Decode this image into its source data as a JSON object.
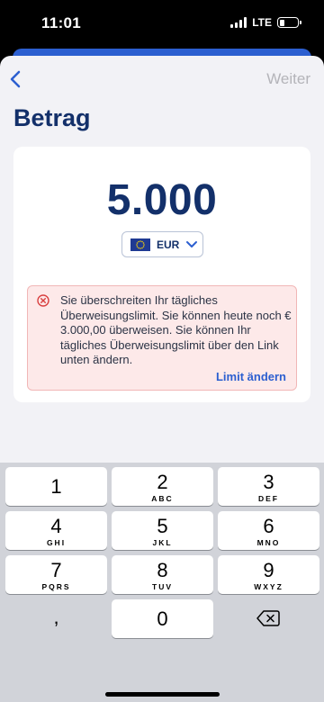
{
  "status_bar": {
    "time": "11:01",
    "network": "LTE",
    "battery_level": 0.2
  },
  "nav": {
    "back_icon": "chevron-left-icon",
    "next_label": "Weiter"
  },
  "page": {
    "title": "Betrag"
  },
  "amount": {
    "value": "5.000",
    "currency": "EUR",
    "flag_icon": "eu-flag-icon"
  },
  "error": {
    "icon": "error-circle-icon",
    "message": "Sie überschreiten Ihr tägliches Überweisungslimit. Sie können heute noch € 3.000,00 überweisen. Sie können Ihr tägliches Überweisungslimit über den Link unten ändern.",
    "link_label": "Limit ändern"
  },
  "keyboard": {
    "keys": [
      {
        "digit": "1",
        "letters": ""
      },
      {
        "digit": "2",
        "letters": "ABC"
      },
      {
        "digit": "3",
        "letters": "DEF"
      },
      {
        "digit": "4",
        "letters": "GHI"
      },
      {
        "digit": "5",
        "letters": "JKL"
      },
      {
        "digit": "6",
        "letters": "MNO"
      },
      {
        "digit": "7",
        "letters": "PQRS"
      },
      {
        "digit": "8",
        "letters": "TUV"
      },
      {
        "digit": "9",
        "letters": "WXYZ"
      }
    ],
    "comma": ",",
    "zero": "0",
    "backspace_icon": "backspace-icon"
  },
  "colors": {
    "title_navy": "#13306a",
    "link_blue": "#2c5fd0",
    "error_bg": "#fde9e9",
    "error_red": "#d94040"
  }
}
